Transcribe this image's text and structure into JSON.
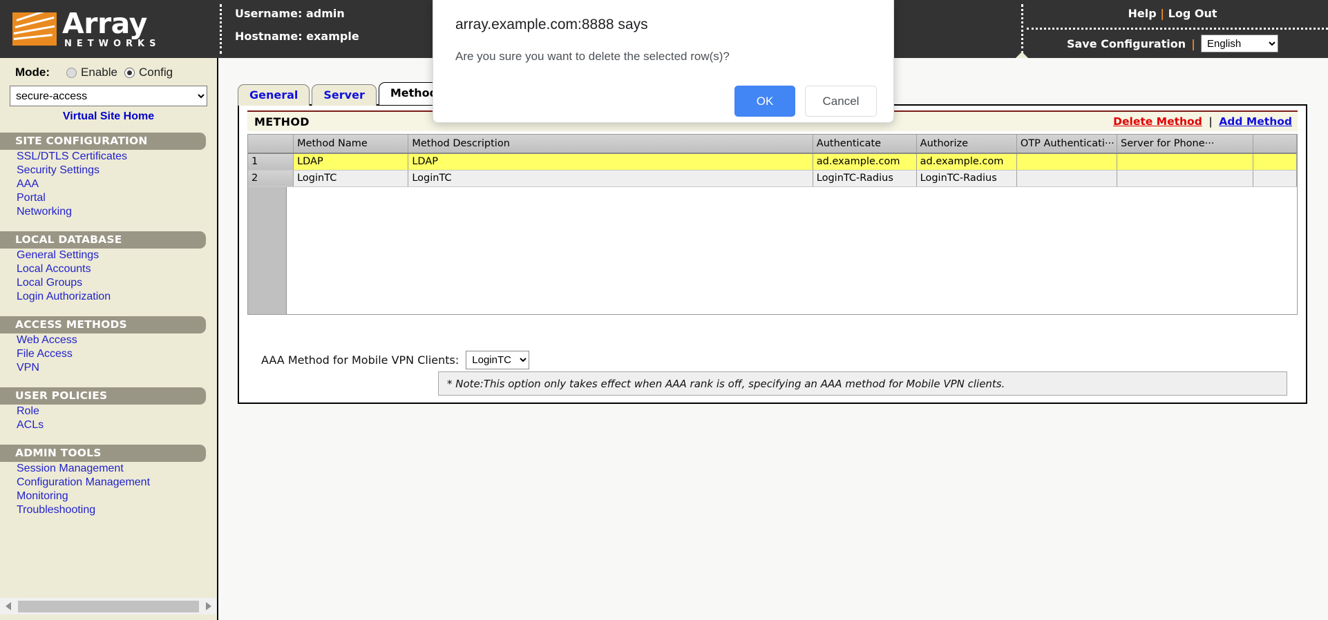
{
  "header": {
    "logo_primary": "Array",
    "logo_secondary": "NETWORKS",
    "username_line": "Username: admin",
    "hostname_line": "Hostname: example",
    "help_label": "Help",
    "logout_label": "Log Out",
    "links_separator": "|",
    "save_config_label": "Save Configuration",
    "language_selected": "English",
    "language_options": [
      "English"
    ]
  },
  "sidebar": {
    "mode_label": "Mode:",
    "mode_options": [
      {
        "label": "Enable",
        "selected": false
      },
      {
        "label": "Config",
        "selected": true
      }
    ],
    "site_selected": "secure-access",
    "site_options": [
      "secure-access"
    ],
    "virtual_site_home": "Virtual Site Home",
    "groups": [
      {
        "title": "SITE CONFIGURATION",
        "items": [
          "SSL/DTLS Certificates",
          "Security Settings",
          "AAA",
          "Portal",
          "Networking"
        ]
      },
      {
        "title": "LOCAL DATABASE",
        "items": [
          "General Settings",
          "Local Accounts",
          "Local Groups",
          "Login Authorization"
        ]
      },
      {
        "title": "ACCESS METHODS",
        "items": [
          "Web Access",
          "File Access",
          "VPN"
        ]
      },
      {
        "title": "USER POLICIES",
        "items": [
          "Role",
          "ACLs"
        ]
      },
      {
        "title": "ADMIN TOOLS",
        "items": [
          "Session Management",
          "Configuration Management",
          "Monitoring",
          "Troubleshooting"
        ]
      }
    ]
  },
  "main": {
    "tabs": [
      {
        "label": "General",
        "active": false
      },
      {
        "label": "Server",
        "active": false
      },
      {
        "label": "Method",
        "active": true
      }
    ],
    "panel_title": "METHOD",
    "delete_label": "Delete Method",
    "actions_separator": "|",
    "add_label": "Add Method",
    "table": {
      "columns": [
        "Method Name",
        "Method Description",
        "Authenticate",
        "Authorize",
        "OTP Authenticati···",
        "Server for Phone···",
        ""
      ],
      "rows": [
        {
          "index": "1",
          "selected": true,
          "cells": [
            "LDAP",
            "LDAP",
            "ad.example.com",
            "ad.example.com",
            "",
            "",
            ""
          ]
        },
        {
          "index": "2",
          "selected": false,
          "cells": [
            "LoginTC",
            "LoginTC",
            "LoginTC-Radius",
            "LoginTC-Radius",
            "",
            "",
            ""
          ]
        }
      ]
    },
    "aaa_method_label": "AAA Method for Mobile VPN Clients:",
    "aaa_method_selected": "LoginTC",
    "aaa_method_options": [
      "LoginTC"
    ],
    "note_text": "* Note:This option only takes effect when AAA rank is off, specifying an AAA method for Mobile VPN clients."
  },
  "modal": {
    "title": "array.example.com:8888 says",
    "message": "Are you sure you want to delete the selected row(s)?",
    "ok_label": "OK",
    "cancel_label": "Cancel"
  },
  "colors": {
    "header_bg": "#333333",
    "brand_orange": "#E98A20",
    "sidebar_bg": "#EDEBD5",
    "nav_group_bg": "#9A9685",
    "link_blue": "#2222CC",
    "delete_red": "#E00000",
    "row_selected_yellow": "#FFFF66",
    "modal_ok_blue": "#4285F4",
    "panel_rule_maroon": "#7B1D17"
  }
}
